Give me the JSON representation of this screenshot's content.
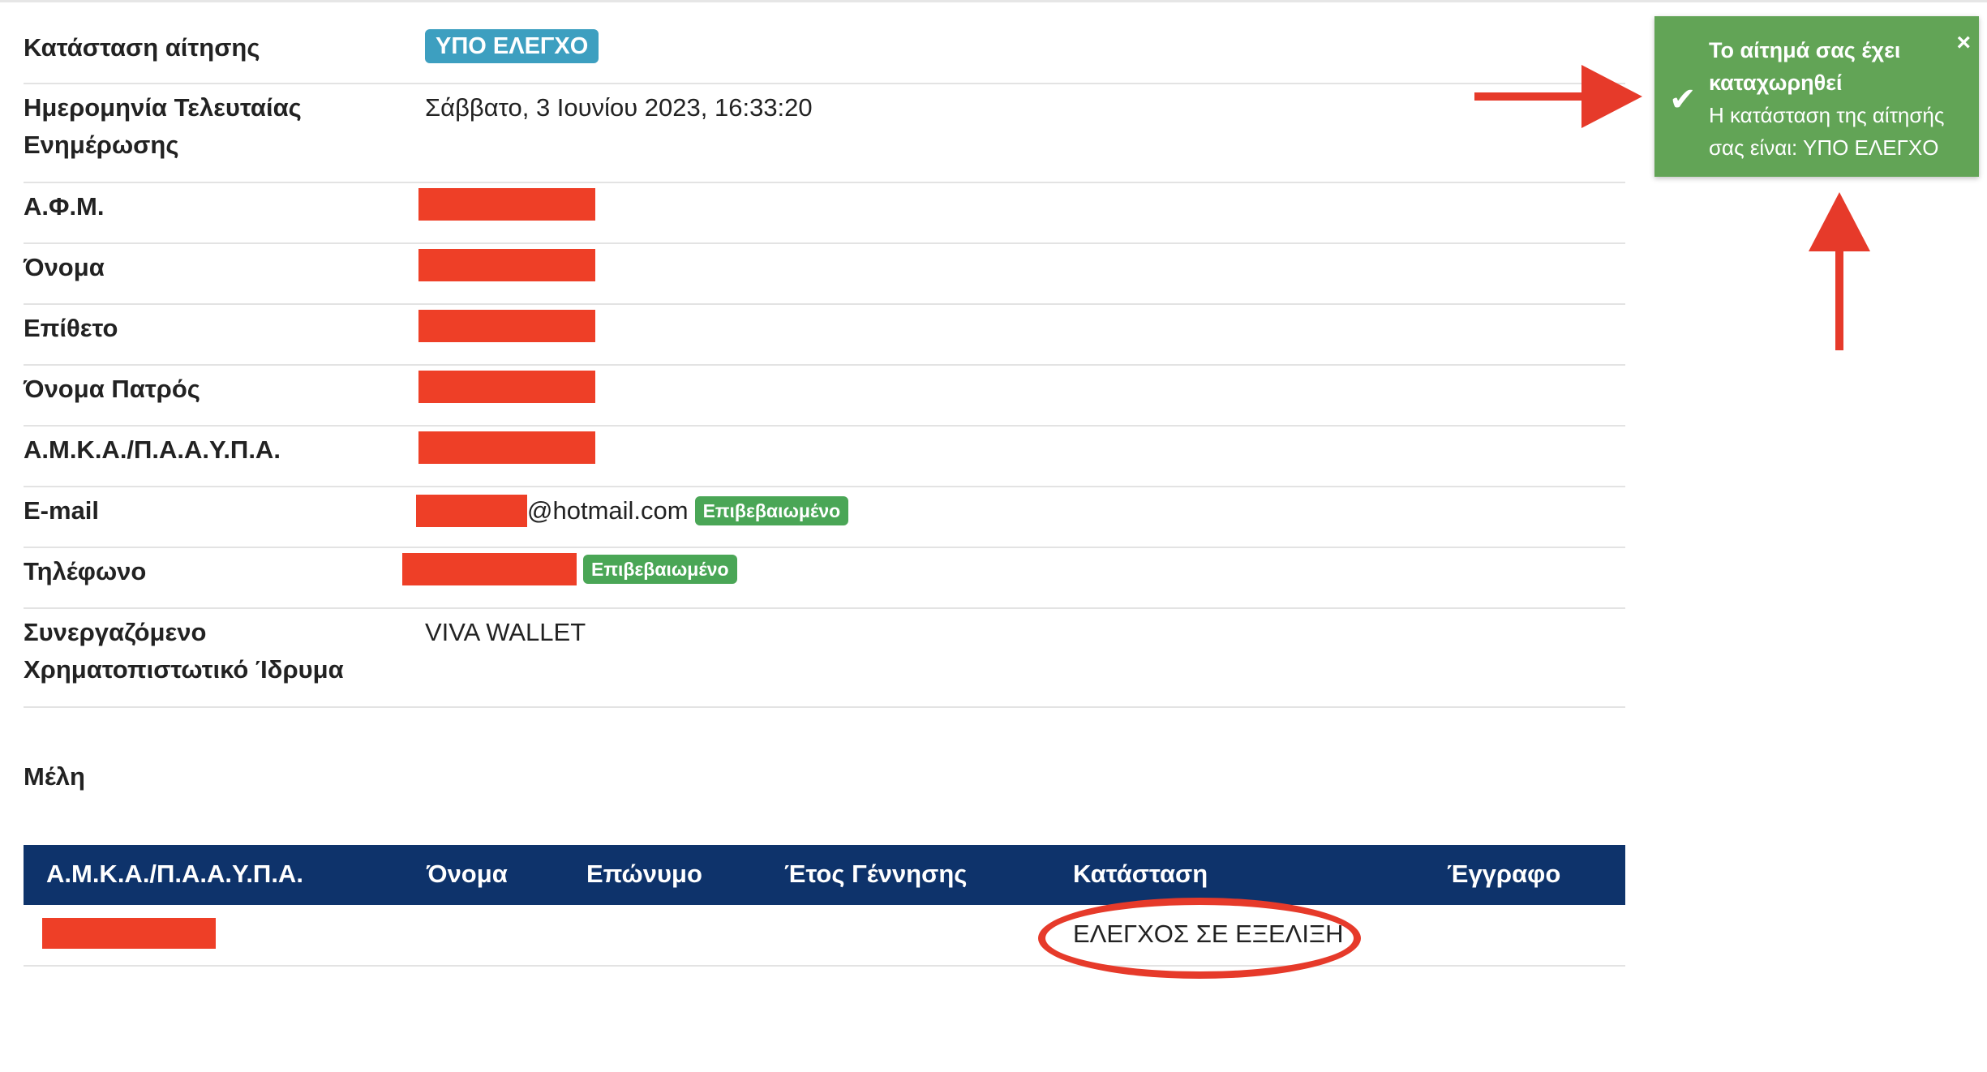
{
  "details": {
    "rows": [
      {
        "label": "Κατάσταση αίτησης",
        "status_badge": "ΥΠΟ ΕΛΕΓΧΟ"
      },
      {
        "label_line1": "Ημερομηνία Τελευταίας",
        "label_line2": "Ενημέρωσης",
        "value": "Σάββατο, 3 Ιουνίου 2023, 16:33:20"
      },
      {
        "label": "Α.Φ.Μ."
      },
      {
        "label": "Όνομα"
      },
      {
        "label": "Επίθετο"
      },
      {
        "label": "Όνομα Πατρός"
      },
      {
        "label": "Α.Μ.Κ.Α./Π.Α.Α.Υ.Π.Α."
      },
      {
        "label": "E-mail",
        "value_suffix": "@hotmail.com",
        "verified_badge": "Επιβεβαιωμένο"
      },
      {
        "label": "Τηλέφωνο",
        "verified_badge": "Επιβεβαιωμένο"
      },
      {
        "label_line1": "Συνεργαζόμενο",
        "label_line2": "Χρηματοπιστωτικό Ίδρυμα",
        "value": "VIVA WALLET"
      }
    ]
  },
  "members": {
    "title": "Μέλη",
    "columns": [
      "Α.Μ.Κ.Α./Π.Α.Α.Υ.Π.Α.",
      "Όνομα",
      "Επώνυμο",
      "Έτος Γέννησης",
      "Κατάσταση",
      "Έγγραφο"
    ],
    "rows": [
      {
        "status": "ΕΛΕΓΧΟΣ ΣΕ ΕΞΕΛΙΞΗ"
      }
    ]
  },
  "toast": {
    "title": "Το αίτημά σας έχει καταχωρηθεί",
    "message": "Η κατάσταση της αίτησής σας είναι: ΥΠΟ ΕΛΕΓΧΟ",
    "close_glyph": "×",
    "check_glyph": "✔"
  },
  "colors": {
    "status_badge": "#3d9fc0",
    "verified_badge": "#4aa656",
    "table_header": "#0e336b",
    "toast_bg": "#62a456",
    "redaction": "#ee3f27",
    "annotation": "#e63a2a"
  }
}
